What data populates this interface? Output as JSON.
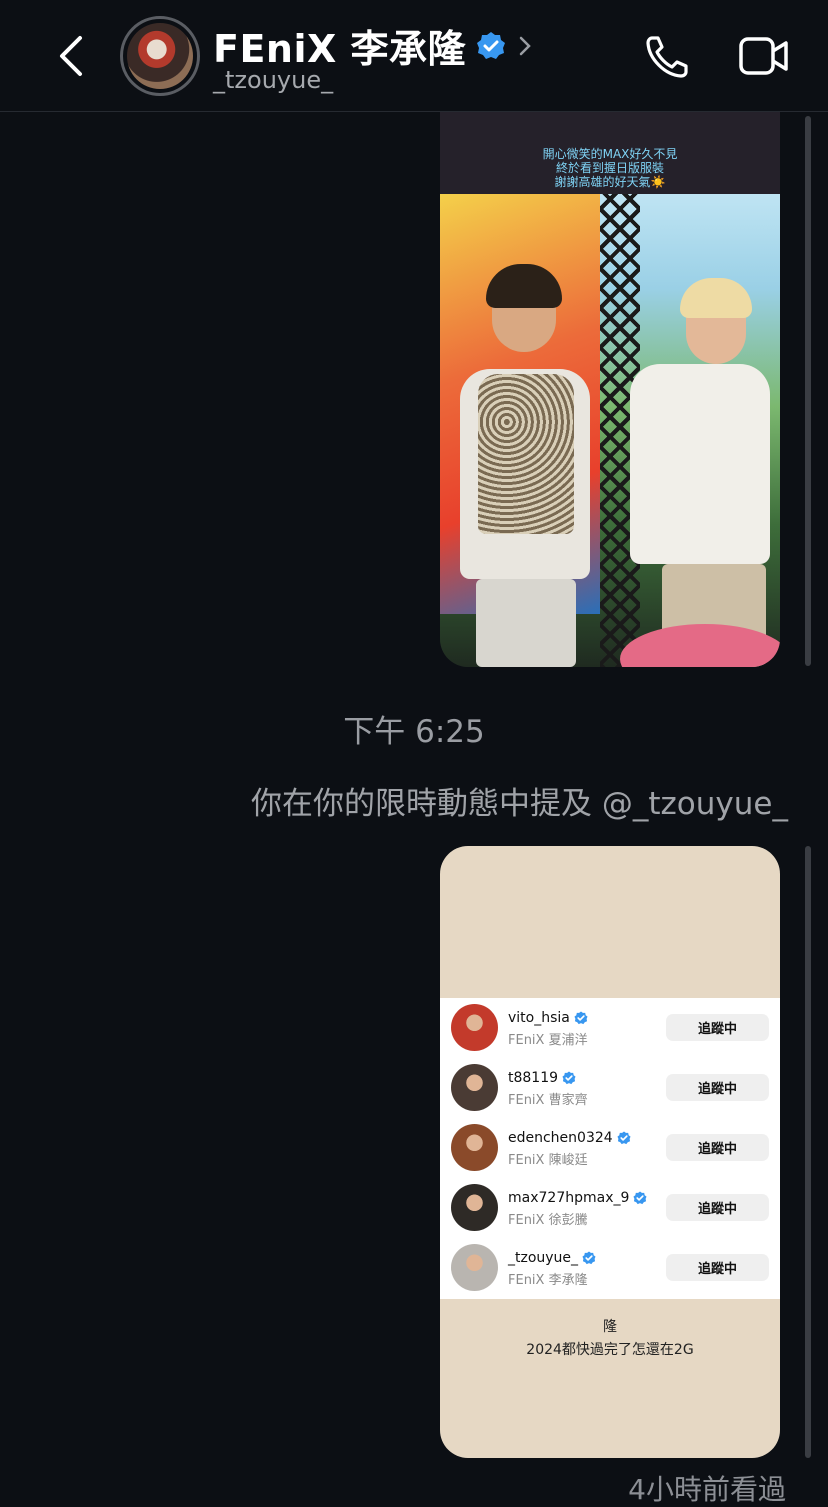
{
  "header": {
    "title": "FEniX 李承隆",
    "handle": "_tzouyue_"
  },
  "story1": {
    "caption_lines": [
      "開心微笑的MAX好久不見",
      "終於看到握日版服裝",
      "謝謝高雄的好天氣☀️"
    ]
  },
  "timestamp": "下午 6:25",
  "mention_text": "你在你的限時動態中提及 @_tzouyue_",
  "story2": {
    "follow_rows": [
      {
        "username": "vito_hsia",
        "name": "FEniX 夏浦洋",
        "button": "追蹤中",
        "avatar_color": "#c33a2b"
      },
      {
        "username": "t88119",
        "name": "FEniX 曹家齊",
        "button": "追蹤中",
        "avatar_color": "#4a3b34"
      },
      {
        "username": "edenchen0324",
        "name": "FEniX 陳峻廷",
        "button": "追蹤中",
        "avatar_color": "#8a4a2a"
      },
      {
        "username": "max727hpmax_9",
        "name": "FEniX 徐彭騰",
        "button": "追蹤中",
        "avatar_color": "#2e2a26"
      },
      {
        "username": "_tzouyue_",
        "name": "FEniX 李承隆",
        "button": "追蹤中",
        "avatar_color": "#b9b5b0"
      }
    ],
    "caption_lines": [
      "隆",
      "2024都快過完了怎還在2G"
    ]
  },
  "seen_text": "4小時前看過",
  "colors": {
    "background": "#0c0f14",
    "verified": "#3897f0",
    "story2_bg": "#e6d8c4"
  }
}
